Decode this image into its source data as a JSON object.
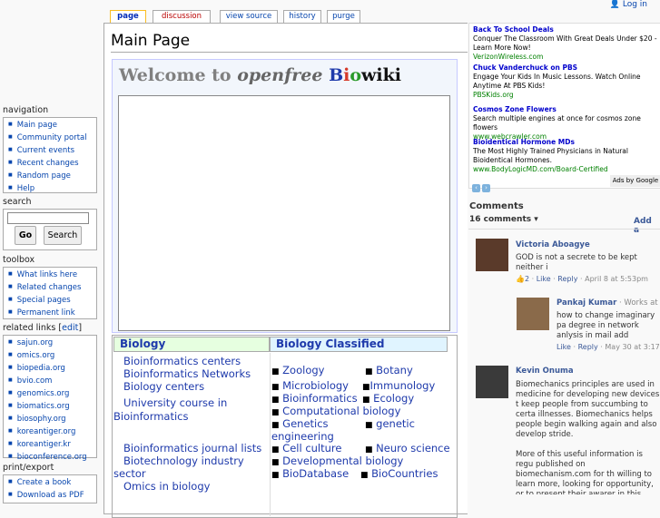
{
  "personal": {
    "login_label": "Log in"
  },
  "tabs": [
    {
      "label": "page"
    },
    {
      "label": "discussion"
    },
    {
      "label": "view source"
    },
    {
      "label": "history"
    },
    {
      "label": "purge"
    }
  ],
  "page": {
    "title": "Main Page"
  },
  "welcome": {
    "w1": "Welcome to ",
    "w2": "openfree ",
    "bio_b": "B",
    "bio_i": "i",
    "bio_o": "o",
    "wiki": "wiki"
  },
  "biology": {
    "header": "Biology",
    "links": [
      "Bioinformatics centers",
      "Bioinformatics Networks",
      "Biology centers",
      "University course in",
      "Bioinformatics",
      "Bioinformatics journal lists",
      "Biotechnology industry",
      "sector",
      "Omics in biology"
    ]
  },
  "classified": {
    "header": "Biology Classified",
    "items": [
      "Zoology",
      "Botany",
      "Microbiology",
      "Immunology",
      "Bioinformatics",
      "Ecology",
      "Computational biology",
      "Genetics",
      "genetic",
      "engineering",
      "Cell culture",
      "Neuro science",
      "Developmental biology",
      "BioDatabase",
      "BioCountries"
    ]
  },
  "sidebar": {
    "navigation": {
      "title": "navigation",
      "items": [
        "Main page",
        "Community portal",
        "Current events",
        "Recent changes",
        "Random page",
        "Help"
      ]
    },
    "search": {
      "title": "search",
      "go": "Go",
      "search": "Search"
    },
    "toolbox": {
      "title": "toolbox",
      "items": [
        "What links here",
        "Related changes",
        "Special pages",
        "Permanent link"
      ]
    },
    "related": {
      "title": "related links [",
      "edit": "edit",
      "close": "]",
      "items": [
        "sajun.org",
        "omics.org",
        "biopedia.org",
        "bvio.com",
        "genomics.org",
        "biomatics.org",
        "biosophy.org",
        "koreantiger.org",
        "koreantiger.kr",
        "bioconference.org"
      ]
    },
    "print": {
      "title": "print/export",
      "items": [
        "Create a book",
        "Download as PDF"
      ]
    }
  },
  "ads": {
    "items": [
      {
        "title": "Back To School Deals",
        "desc": "Conquer The Classroom With Great Deals Under $20 - Learn More Now!",
        "url": "VerizonWireless.com"
      },
      {
        "title": "Chuck Vanderchuck on PBS",
        "desc": "Engage Your Kids In Music Lessons. Watch Online Anytime At PBS Kids!",
        "url": "PBSKids.org"
      },
      {
        "title": "Cosmos Zone Flowers",
        "desc": "Search multiple engines at once for cosmos zone flowers",
        "url": "www.webcrawler.com"
      },
      {
        "title": "Bioidentical Hormone MDs",
        "desc": "The Most Highly Trained Physicians in Natural Bioidentical Hormones.",
        "url": "www.BodyLogicMD.com/Board-Certified"
      }
    ],
    "ads_by": "Ads by Google"
  },
  "comments": {
    "title": "Comments",
    "count": "16 comments ▾",
    "add": "Add a",
    "list": [
      {
        "name": "Victoria Aboagye",
        "text": "GOD is not a secrete to be kept neither i",
        "likes": "2",
        "like": "Like",
        "reply": "Reply",
        "date": "April 8 at 5:53pm"
      },
      {
        "name": "Pankaj Kumar",
        "sub": " · Works at S",
        "text": "how to change imaginary pa degree in network anlysis in mail add",
        "like": "Like",
        "reply": "Reply",
        "date": "May 30 at 3:17"
      },
      {
        "name": "Kevin Onuma",
        "text": "Biomechanics principles are used in medicine for developing new devices t keep people from succumbing to certa illnesses. Biomechanics helps people begin walking again and also develop stride.\n\nMore of this useful information is regu published on biomechanism.com for th willing to learn more, looking for opportunity, or to present their awarer in this field."
      }
    ]
  }
}
